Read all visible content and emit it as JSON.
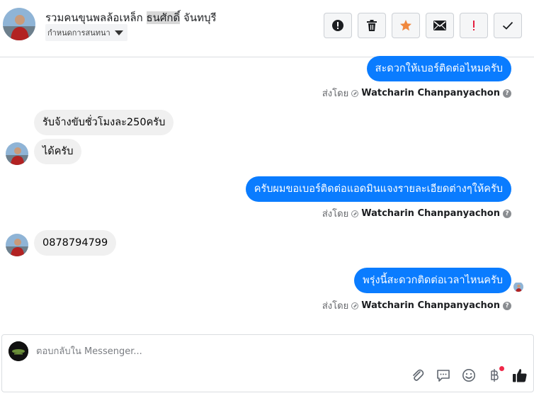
{
  "header": {
    "title_pre": "รวมคนขุนพลล้อเหล็ก ",
    "title_hl": "ธนศักดิ์",
    "title_post": " จันทบุรี",
    "assign_label": "กำหนดการสนทนา",
    "actions": [
      "exclamation-icon",
      "trash-icon",
      "star-icon",
      "mail-icon",
      "important-icon",
      "check-icon"
    ],
    "colors": {
      "star": "#f0883e",
      "important": "#e41e3f",
      "icon": "#1c1e21"
    }
  },
  "messages": [
    {
      "dir": "out",
      "text": "สะดวกให้เบอร์ติดต่อไหมครับ"
    },
    {
      "dir": "in",
      "text": "รับจ้างขับชั่วโมงละ250ครับ"
    },
    {
      "dir": "in",
      "text": "ได้ครับ"
    },
    {
      "dir": "out",
      "text": "ครับผมขอเบอร์ติดต่อแอดมินแจงรายละเอียดต่างๆให้ครับ"
    },
    {
      "dir": "in",
      "text": "0878794799"
    },
    {
      "dir": "out",
      "text": "พรุ่งนี้สะดวกติดต่อเวลาไหนครับ"
    }
  ],
  "meta": {
    "sent_by": "ส่งโดย",
    "sender": "Watcharin Chanpanyachon",
    "help": "?"
  },
  "composer": {
    "placeholder": "ตอบกลับใน Messenger..."
  },
  "colors": {
    "outgoing": "#0a7cff",
    "incoming": "#f0f0f0",
    "like": "#1c1e21",
    "badge": "#f02849"
  }
}
